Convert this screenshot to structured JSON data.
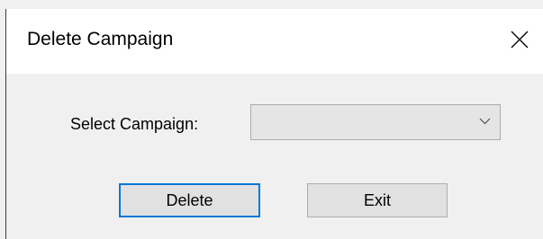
{
  "window": {
    "title": "Delete Campaign",
    "close_icon": "close-icon"
  },
  "form": {
    "campaign_label": "Select Campaign:",
    "campaign_value": "",
    "dropdown_icon": "chevron-down-icon"
  },
  "buttons": {
    "delete_label": "Delete",
    "exit_label": "Exit"
  },
  "colors": {
    "dialog_background": "#f0f0f0",
    "titlebar_background": "#ffffff",
    "focus_accent": "#0078d7",
    "button_face": "#e1e1e1"
  }
}
